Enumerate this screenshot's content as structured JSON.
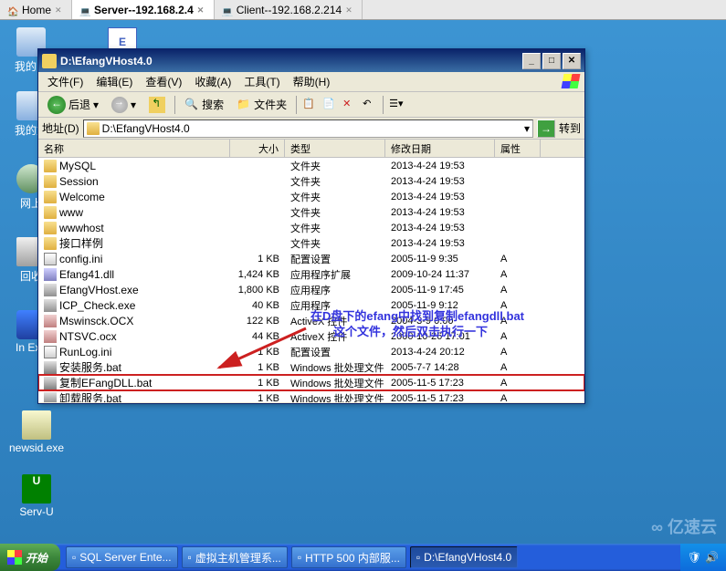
{
  "browser_tabs": [
    {
      "label": "Home",
      "icon": "home-icon"
    },
    {
      "label": "Server--192.168.2.4",
      "icon": "server-icon",
      "active": true
    },
    {
      "label": "Client--192.168.2.214",
      "icon": "client-icon"
    }
  ],
  "desktop": {
    "my_computer": "我的电",
    "my_network": "我的文",
    "network_places": "网上",
    "recycle": "回收",
    "ie_left": "In\nExp",
    "newsid": "newsid.exe",
    "servu": "Serv-U",
    "top_icon": "E"
  },
  "explorer": {
    "title": "D:\\EfangVHost4.0",
    "menus": {
      "file": "文件(F)",
      "edit": "编辑(E)",
      "view": "查看(V)",
      "favorites": "收藏(A)",
      "tools": "工具(T)",
      "help": "帮助(H)"
    },
    "toolbar": {
      "back": "后退",
      "search": "搜索",
      "folders": "文件夹"
    },
    "address": {
      "label": "地址(D)",
      "path": "D:\\EfangVHost4.0",
      "go": "转到"
    },
    "columns": {
      "name": "名称",
      "size": "大小",
      "type": "类型",
      "date": "修改日期",
      "attr": "属性"
    },
    "files": [
      {
        "name": "MySQL",
        "size": "",
        "type": "文件夹",
        "date": "2013-4-24 19:53",
        "attr": "",
        "icon": "folder-i"
      },
      {
        "name": "Session",
        "size": "",
        "type": "文件夹",
        "date": "2013-4-24 19:53",
        "attr": "",
        "icon": "folder-i"
      },
      {
        "name": "Welcome",
        "size": "",
        "type": "文件夹",
        "date": "2013-4-24 19:53",
        "attr": "",
        "icon": "folder-i"
      },
      {
        "name": "www",
        "size": "",
        "type": "文件夹",
        "date": "2013-4-24 19:53",
        "attr": "",
        "icon": "folder-i"
      },
      {
        "name": "wwwhost",
        "size": "",
        "type": "文件夹",
        "date": "2013-4-24 19:53",
        "attr": "",
        "icon": "folder-i"
      },
      {
        "name": "接口样例",
        "size": "",
        "type": "文件夹",
        "date": "2013-4-24 19:53",
        "attr": "",
        "icon": "folder-i"
      },
      {
        "name": "config.ini",
        "size": "1 KB",
        "type": "配置设置",
        "date": "2005-11-9 9:35",
        "attr": "A",
        "icon": "ini-i"
      },
      {
        "name": "Efang41.dll",
        "size": "1,424 KB",
        "type": "应用程序扩展",
        "date": "2009-10-24 11:37",
        "attr": "A",
        "icon": "dll-i"
      },
      {
        "name": "EfangVHost.exe",
        "size": "1,800 KB",
        "type": "应用程序",
        "date": "2005-11-9 17:45",
        "attr": "A",
        "icon": "exe-i"
      },
      {
        "name": "ICP_Check.exe",
        "size": "40 KB",
        "type": "应用程序",
        "date": "2005-11-9 9:12",
        "attr": "A",
        "icon": "exe-i"
      },
      {
        "name": "Mswinsck.OCX",
        "size": "122 KB",
        "type": "ActiveX 控件",
        "date": "2004-3-9 0:00",
        "attr": "A",
        "icon": "ocx-i"
      },
      {
        "name": "NTSVC.ocx",
        "size": "44 KB",
        "type": "ActiveX 控件",
        "date": "2000-10-26 17:01",
        "attr": "A",
        "icon": "ocx-i"
      },
      {
        "name": "RunLog.ini",
        "size": "1 KB",
        "type": "配置设置",
        "date": "2013-4-24 20:12",
        "attr": "A",
        "icon": "ini-i"
      },
      {
        "name": "安装服务.bat",
        "size": "1 KB",
        "type": "Windows 批处理文件",
        "date": "2005-7-7 14:28",
        "attr": "A",
        "icon": "bat-i"
      },
      {
        "name": "复制EFangDLL.bat",
        "size": "1 KB",
        "type": "Windows 批处理文件",
        "date": "2005-11-5 17:23",
        "attr": "A",
        "icon": "bat-i",
        "highlighted": true
      },
      {
        "name": "卸载服务.bat",
        "size": "1 KB",
        "type": "Windows 批处理文件",
        "date": "2005-11-5 17:23",
        "attr": "A",
        "icon": "bat-i"
      }
    ]
  },
  "annotation": {
    "line1": "在D盘下的efang中找到复制efangdll.bat",
    "line2": "这个文件，然后双击执行一下"
  },
  "taskbar": {
    "start": "开始",
    "items": [
      {
        "label": "SQL Server Ente..."
      },
      {
        "label": "虚拟主机管理系..."
      },
      {
        "label": "HTTP 500 内部服..."
      },
      {
        "label": "D:\\EfangVHost4.0",
        "active": true
      }
    ]
  },
  "watermark": "亿速云"
}
